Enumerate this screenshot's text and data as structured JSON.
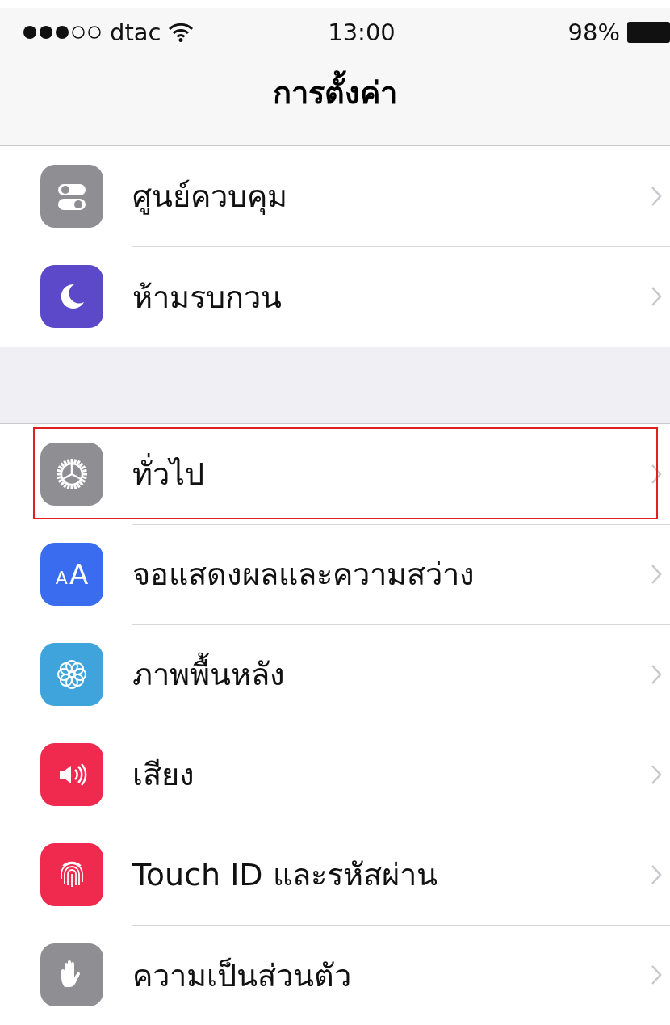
{
  "status_bar": {
    "carrier": "dtac",
    "time": "13:00",
    "battery": "98%"
  },
  "navigation": {
    "title": "การตั้งค่า"
  },
  "groups": [
    {
      "rows": [
        {
          "label": "ศูนย์ควบคุม",
          "kind": "toggles",
          "color": "#8e8e93",
          "highlighted": false
        },
        {
          "label": "ห้ามรบกวน",
          "kind": "moon",
          "color": "#5b49c9",
          "highlighted": false
        }
      ]
    },
    {
      "rows": [
        {
          "label": "ทั่วไป",
          "kind": "gear",
          "color": "#8e8e93",
          "highlighted": true
        },
        {
          "label": "จอแสดงผลและความสว่าง",
          "kind": "text-size",
          "color": "#3a6cf0",
          "icon_text": "AA",
          "highlighted": false
        },
        {
          "label": "ภาพพื้นหลัง",
          "kind": "flower",
          "color": "#3fa3dc",
          "highlighted": false
        },
        {
          "label": "เสียง",
          "kind": "speaker",
          "color": "#f0294f",
          "highlighted": false
        },
        {
          "label": "Touch ID และรหัสผ่าน",
          "kind": "fingerprint",
          "color": "#f0294f",
          "highlighted": false
        },
        {
          "label": "ความเป็นส่วนตัว",
          "kind": "hand",
          "color": "#8e8e93",
          "highlighted": false
        }
      ]
    }
  ]
}
